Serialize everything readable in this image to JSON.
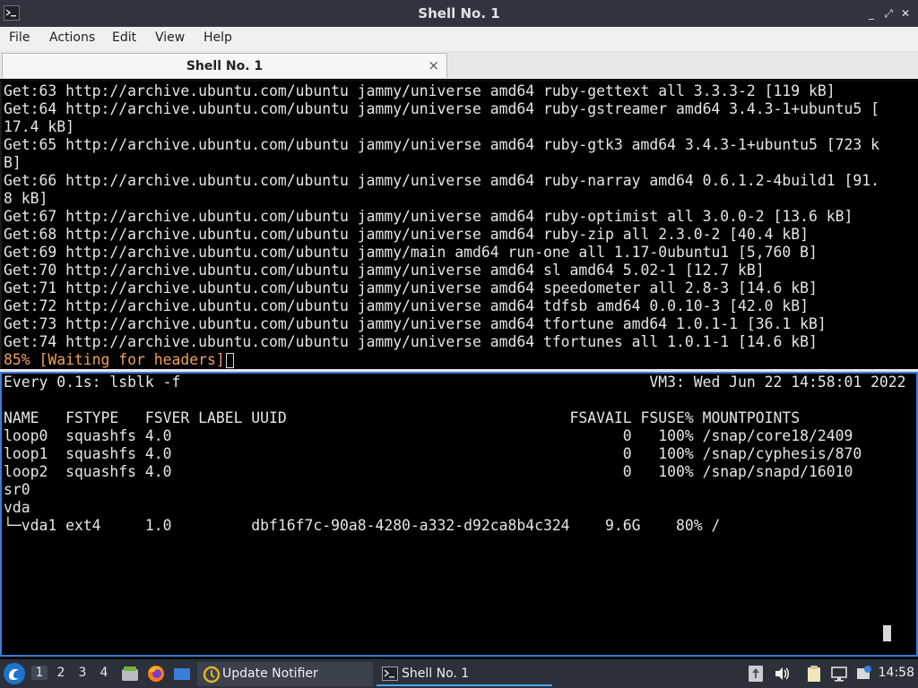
{
  "window": {
    "title": "Shell No. 1",
    "controls": {
      "minimize": "_",
      "restore": "⤢",
      "close": "✕"
    }
  },
  "menubar": [
    "File",
    "Actions",
    "Edit",
    "View",
    "Help"
  ],
  "tabs": [
    {
      "label": "Shell No. 1",
      "close": "×"
    }
  ],
  "terminal_top": {
    "lines": [
      "Get:63 http://archive.ubuntu.com/ubuntu jammy/universe amd64 ruby-gettext all 3.3.3-2 [119 kB]",
      "Get:64 http://archive.ubuntu.com/ubuntu jammy/universe amd64 ruby-gstreamer amd64 3.4.3-1+ubuntu5 [",
      "17.4 kB]",
      "Get:65 http://archive.ubuntu.com/ubuntu jammy/universe amd64 ruby-gtk3 amd64 3.4.3-1+ubuntu5 [723 k",
      "B]",
      "Get:66 http://archive.ubuntu.com/ubuntu jammy/universe amd64 ruby-narray amd64 0.6.1.2-4build1 [91.",
      "8 kB]",
      "Get:67 http://archive.ubuntu.com/ubuntu jammy/universe amd64 ruby-optimist all 3.0.0-2 [13.6 kB]",
      "Get:68 http://archive.ubuntu.com/ubuntu jammy/universe amd64 ruby-zip all 2.3.0-2 [40.4 kB]",
      "Get:69 http://archive.ubuntu.com/ubuntu jammy/main amd64 run-one all 1.17-0ubuntu1 [5,760 B]",
      "Get:70 http://archive.ubuntu.com/ubuntu jammy/universe amd64 sl amd64 5.02-1 [12.7 kB]",
      "Get:71 http://archive.ubuntu.com/ubuntu jammy/universe amd64 speedometer all 2.8-3 [14.6 kB]",
      "Get:72 http://archive.ubuntu.com/ubuntu jammy/universe amd64 tdfsb amd64 0.0.10-3 [42.0 kB]",
      "Get:73 http://archive.ubuntu.com/ubuntu jammy/universe amd64 tfortune amd64 1.0.1-1 [36.1 kB]",
      "Get:74 http://archive.ubuntu.com/ubuntu jammy/universe amd64 tfortunes all 1.0.1-1 [14.6 kB]"
    ],
    "progress_line": "85% [Waiting for headers]",
    "progress_color": "#f0a05a"
  },
  "terminal_bottom": {
    "lines": [
      "Every 0.1s: lsblk -f                                                     VM3: Wed Jun 22 14:58:01 2022",
      "",
      "NAME   FSTYPE   FSVER LABEL UUID                                FSAVAIL FSUSE% MOUNTPOINTS",
      "loop0  squashfs 4.0                                                   0   100% /snap/core18/2409",
      "loop1  squashfs 4.0                                                   0   100% /snap/cyphesis/870",
      "loop2  squashfs 4.0                                                   0   100% /snap/snapd/16010",
      "sr0",
      "vda",
      "└─vda1 ext4     1.0         dbf16f7c-90a8-4280-a332-d92ca8b4c324    9.6G    80% /"
    ]
  },
  "taskbar": {
    "workspaces": [
      "1",
      "2",
      "3",
      "4"
    ],
    "active_workspace": "1",
    "tasks": [
      {
        "label": "Update Notifier",
        "icon": "update-notifier-icon"
      },
      {
        "label": "Shell No. 1",
        "icon": "terminal-icon"
      }
    ],
    "clock": "14:58"
  },
  "colors": {
    "titlebar": "#2f343f",
    "active_pane_border": "#3b7dd8",
    "taskbar": "#2b303b"
  }
}
